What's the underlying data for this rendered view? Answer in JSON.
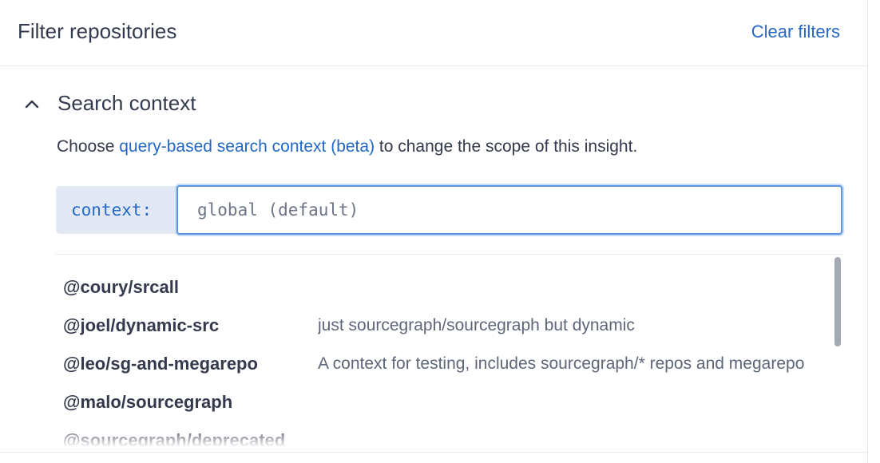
{
  "header": {
    "title": "Filter repositories",
    "clear_label": "Clear filters"
  },
  "section": {
    "title": "Search context",
    "expanded": true,
    "icon": "chevron-up-icon",
    "description_prefix": "Choose ",
    "description_link": "query-based search context (beta)",
    "description_suffix": " to change the scope of this insight."
  },
  "context_input": {
    "prefix": "context:",
    "placeholder": "global (default)",
    "value": ""
  },
  "suggestions": [
    {
      "name": "@coury/srcall",
      "description": ""
    },
    {
      "name": "@joel/dynamic-src",
      "description": "just sourcegraph/sourcegraph but dynamic"
    },
    {
      "name": "@leo/sg-and-megarepo",
      "description": "A context for testing, includes sourcegraph/* repos and megarepo"
    },
    {
      "name": "@malo/sourcegraph",
      "description": ""
    },
    {
      "name": "@sourcegraph/deprecated",
      "description": ""
    }
  ],
  "colors": {
    "link": "#2368c6",
    "focus_border": "#5b94de",
    "prefix_bg": "#e3e9f4",
    "text": "#343a4d",
    "muted": "#5e667a"
  }
}
